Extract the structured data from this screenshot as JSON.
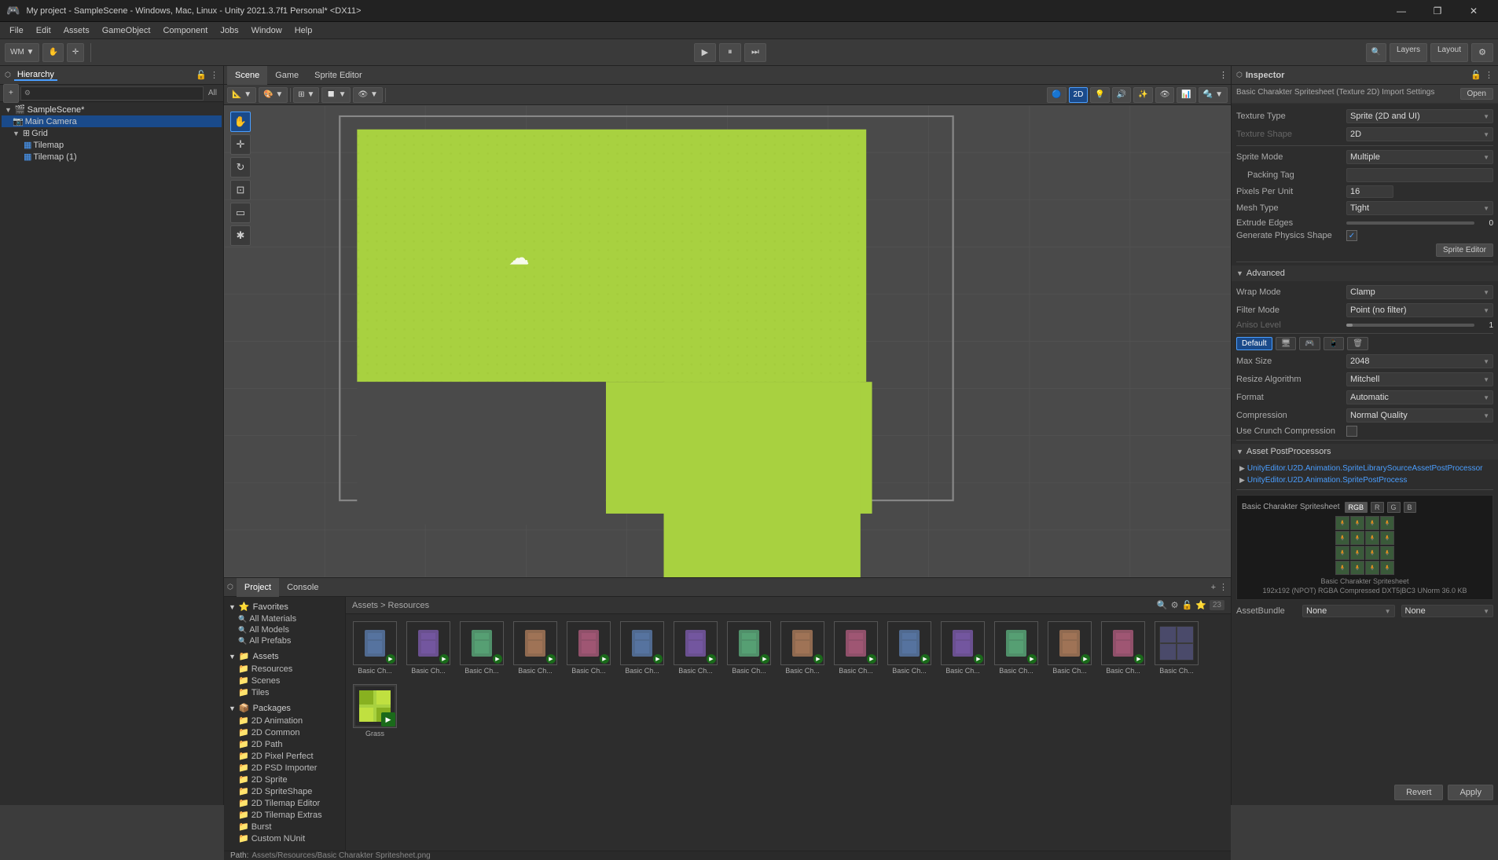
{
  "titlebar": {
    "title": "My project - SampleScene - Windows, Mac, Linux - Unity 2021.3.7f1 Personal* <DX11>",
    "icon": "🎮",
    "minimize": "—",
    "maximize": "❐",
    "close": "✕"
  },
  "menubar": {
    "items": [
      "File",
      "Edit",
      "Assets",
      "GameObject",
      "Component",
      "Jobs",
      "Window",
      "Help"
    ]
  },
  "toolbar": {
    "wm_label": "WM ▼",
    "play_btn": "▶",
    "pause_btn": "⏸",
    "step_btn": "⏭",
    "layers_label": "Layers",
    "layout_label": "Layout"
  },
  "hierarchy": {
    "panel_label": "Hierarchy",
    "add_btn": "+",
    "filter_btn": "⚙",
    "all_label": "All",
    "items": [
      {
        "label": "SampleScene*",
        "level": 0,
        "arrow": "▼",
        "icon": "🎬"
      },
      {
        "label": "Main Camera",
        "level": 1,
        "arrow": "",
        "icon": "📷"
      },
      {
        "label": "Grid",
        "level": 1,
        "arrow": "▼",
        "icon": "⊞"
      },
      {
        "label": "Tilemap",
        "level": 2,
        "arrow": "",
        "icon": "▦"
      },
      {
        "label": "Tilemap (1)",
        "level": 2,
        "arrow": "",
        "icon": "▦"
      }
    ]
  },
  "view_tabs": {
    "scene": "Scene",
    "game": "Game",
    "sprite_editor": "Sprite Editor"
  },
  "inspector": {
    "panel_label": "Inspector",
    "asset_name": "Basic Charakter Spritesheet (Texture 2D) Import Settings",
    "open_btn": "Open",
    "texture_type_label": "Texture Type",
    "texture_type_value": "Sprite (2D and UI)",
    "texture_shape_label": "Texture Shape",
    "texture_shape_value": "2D",
    "sprite_mode_label": "Sprite Mode",
    "sprite_mode_value": "Multiple",
    "packing_tag_label": "Packing Tag",
    "packing_tag_value": "",
    "pixels_per_unit_label": "Pixels Per Unit",
    "pixels_per_unit_value": "16",
    "mesh_type_label": "Mesh Type",
    "mesh_type_value": "Tight",
    "extrude_edges_label": "Extrude Edges",
    "extrude_edges_slider": 0,
    "extrude_edges_value": "0",
    "gen_physics_label": "Generate Physics Shape",
    "gen_physics_checked": true,
    "sprite_editor_btn": "Sprite Editor",
    "advanced_label": "Advanced",
    "wrap_mode_label": "Wrap Mode",
    "wrap_mode_value": "Clamp",
    "filter_mode_label": "Filter Mode",
    "filter_mode_value": "Point (no filter)",
    "aniso_level_label": "Aniso Level",
    "aniso_level_slider": 1,
    "aniso_level_value": "1",
    "platforms": {
      "default_label": "Default",
      "icons": [
        "🖥",
        "🎮",
        "📱",
        "🗑"
      ]
    },
    "max_size_label": "Max Size",
    "max_size_value": "2048",
    "resize_algo_label": "Resize Algorithm",
    "resize_algo_value": "Mitchell",
    "format_label": "Format",
    "format_value": "Automatic",
    "compression_label": "Compression",
    "compression_value": "Normal Quality",
    "use_crunch_label": "Use Crunch Compression",
    "use_crunch_checked": false,
    "revert_btn": "Revert",
    "apply_btn": "Apply",
    "asset_postprocessors_label": "Asset PostProcessors",
    "postprocessors": [
      "UnityEditor.U2D.Animation.SpriteLibrarySourceAssetPostProcessor",
      "UnityEditor.U2D.Animation.SpritePostProcess"
    ],
    "preview_name": "Basic Charakter Spritesheet",
    "preview_channels": [
      "RGB",
      "R",
      "G",
      "B"
    ],
    "preview_info": "Basic Charakter Spritesheet\n192x192 (NPOT)  RGBA Compressed DXT5|BC3 UNorm  36.0 KB",
    "preview_info_line1": "Basic Charakter Spritesheet",
    "preview_info_line2": "192x192 (NPOT)  RGBA Compressed DXT5|BC3 UNorm  36.0 KB",
    "asset_bundle_label": "AssetBundle",
    "asset_bundle_value": "None",
    "asset_variant_label": "",
    "asset_variant_value": "None"
  },
  "project": {
    "panel_label": "Project",
    "console_label": "Console",
    "favorites": {
      "label": "Favorites",
      "items": [
        "All Materials",
        "All Models",
        "All Prefabs"
      ]
    },
    "assets": {
      "label": "Assets",
      "items": [
        "Resources",
        "Scenes",
        "Tiles"
      ]
    },
    "packages": {
      "label": "Packages",
      "items": [
        "2D Animation",
        "2D Common",
        "2D Path",
        "2D Pixel Perfect",
        "2D PSD Importer",
        "2D Sprite",
        "2D SpritShape",
        "2D Tilemap Editor",
        "2D Tilemap Extras",
        "Burst",
        "CustomNUnit"
      ]
    },
    "path": "Assets > Resources",
    "assets_path": "Assets/Resources/Basic Charakter Spritesheet.png",
    "count": "23",
    "asset_items": [
      {
        "name": "Basic Ch...",
        "type": "sprite",
        "count": 1
      },
      {
        "name": "Basic Ch...",
        "type": "sprite",
        "count": 2
      },
      {
        "name": "Basic Ch...",
        "type": "sprite",
        "count": 3
      },
      {
        "name": "Basic Ch...",
        "type": "sprite",
        "count": 4
      },
      {
        "name": "Basic Ch...",
        "type": "sprite",
        "count": 5
      },
      {
        "name": "Basic Ch...",
        "type": "sprite",
        "count": 6
      },
      {
        "name": "Basic Ch...",
        "type": "sprite",
        "count": 7
      },
      {
        "name": "Basic Ch...",
        "type": "sprite",
        "count": 8
      },
      {
        "name": "Basic Ch...",
        "type": "sprite",
        "count": 9
      },
      {
        "name": "Basic Ch...",
        "type": "sprite",
        "count": 10
      },
      {
        "name": "Basic Ch...",
        "type": "sprite",
        "count": 11
      },
      {
        "name": "Basic Ch...",
        "type": "sprite",
        "count": 12
      },
      {
        "name": "Basic Ch...",
        "type": "sprite",
        "count": 13
      },
      {
        "name": "Basic Ch...",
        "type": "sprite",
        "count": 14
      },
      {
        "name": "Basic Ch...",
        "type": "sprite",
        "count": 15
      },
      {
        "name": "Basic Ch...",
        "type": "sprite_sheet",
        "count": 16
      },
      {
        "name": "Grass",
        "type": "grass",
        "count": 17
      }
    ]
  },
  "scene": {
    "bg_color": "#4a4a4a",
    "grid_color": "#5a5a5a",
    "tile_color": "#a8d140",
    "camera_icon": "☁"
  }
}
